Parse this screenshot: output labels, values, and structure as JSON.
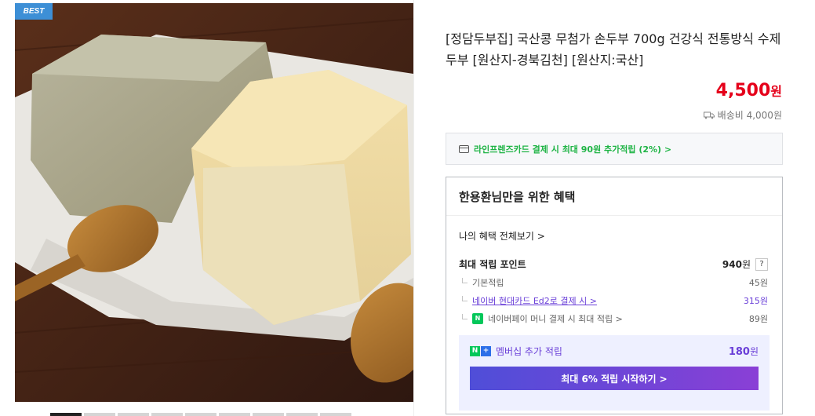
{
  "badge": "BEST",
  "product": {
    "title": "[정담두부집] 국산콩 무첨가 손두부 700g 건강식 전통방식 수제두부 [원산지-경북김천] [원산지:국산]",
    "price": "4,500",
    "price_unit": "원",
    "shipping": "배송비 4,000원"
  },
  "card_banner": "라인프렌즈카드 결제 시 최대 90원 추가적립 (2%) >",
  "benefit": {
    "heading": "한용환님만을 위한 혜택",
    "view_all": "나의 혜택 전체보기 >",
    "max_label": "최대 적립 포인트",
    "max_value": "940",
    "max_unit": "원",
    "help": "?",
    "rows": [
      {
        "label": "기본적립",
        "value": "45원"
      },
      {
        "label": "네이버 현대카드 Ed2로 결제 시 >",
        "value": "315원"
      },
      {
        "label": "네이버페이 머니 결제 시 최대 적립 >",
        "value": "89원"
      }
    ],
    "membership_label": "멤버십 추가 적립",
    "membership_value": "180",
    "membership_unit": "원",
    "cta": "최대 6% 적립 시작하기 >"
  },
  "icons": {
    "shipping": "truck-icon",
    "card": "credit-card-icon",
    "npay": "naver-pay-icon",
    "membership": "naver-plus-icon"
  },
  "colors": {
    "price": "#e5001a",
    "banner_text": "#1fb445",
    "accent_purple": "#6a3fd8",
    "badge": "#3d8fd6"
  }
}
